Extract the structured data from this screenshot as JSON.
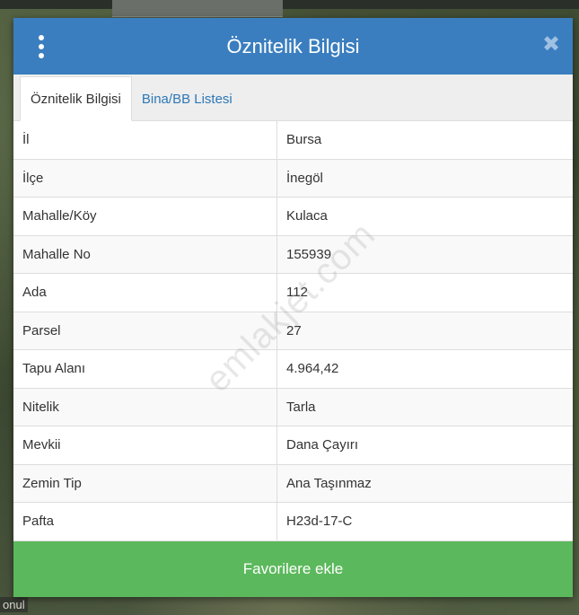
{
  "background": {
    "corner_label": "onul"
  },
  "dialog": {
    "title": "Öznitelik Bilgisi",
    "menu_icon": "vertical-dots-icon",
    "close_icon": "close-icon",
    "close_glyph": "✖",
    "accent_color": "#3a7ebf",
    "tabs": [
      {
        "label": "Öznitelik Bilgisi",
        "active": true
      },
      {
        "label": "Bina/BB Listesi",
        "active": false
      }
    ],
    "rows": [
      {
        "key": "İl",
        "value": "Bursa"
      },
      {
        "key": "İlçe",
        "value": "İnegöl"
      },
      {
        "key": "Mahalle/Köy",
        "value": "Kulaca"
      },
      {
        "key": "Mahalle No",
        "value": "155939"
      },
      {
        "key": "Ada",
        "value": "112"
      },
      {
        "key": "Parsel",
        "value": "27"
      },
      {
        "key": "Tapu Alanı",
        "value": "4.964,42"
      },
      {
        "key": "Nitelik",
        "value": "Tarla"
      },
      {
        "key": "Mevkii",
        "value": "Dana Çayırı"
      },
      {
        "key": "Zemin Tip",
        "value": "Ana Taşınmaz"
      },
      {
        "key": "Pafta",
        "value": "H23d-17-C"
      }
    ],
    "favorite_button_label": "Favorilere ekle",
    "favorite_button_color": "#5cb85c"
  },
  "watermark": "emlakjet.com"
}
